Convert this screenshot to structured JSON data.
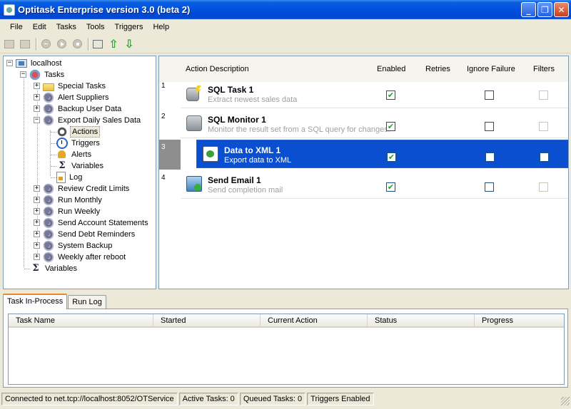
{
  "window": {
    "title": "Optitask Enterprise version 3.0 (beta 2)"
  },
  "menu": [
    "File",
    "Edit",
    "Tasks",
    "Tools",
    "Triggers",
    "Help"
  ],
  "tree": {
    "root": "localhost",
    "tasks_label": "Tasks",
    "tasks": [
      "Special Tasks",
      "Alert Suppliers",
      "Backup User Data",
      "Export Daily Sales Data"
    ],
    "export_children": [
      "Actions",
      "Triggers",
      "Alerts",
      "Variables",
      "Log"
    ],
    "more_tasks": [
      "Review Credit Limits",
      "Run Monthly",
      "Run Weekly",
      "Send Account Statements",
      "Send Debt Reminders",
      "System Backup",
      "Weekly after reboot"
    ],
    "variables_label": "Variables"
  },
  "actions": {
    "columns": [
      "Action Description",
      "Enabled",
      "Retries",
      "Ignore Failure",
      "Filters"
    ],
    "rows": [
      {
        "num": "1",
        "name": "SQL Task 1",
        "desc": "Extract newest sales data",
        "enabled": true,
        "ignore_failure": false,
        "filters": false
      },
      {
        "num": "2",
        "name": "SQL Monitor 1",
        "desc": "Monitor the result set from a SQL query for changes.",
        "enabled": true,
        "ignore_failure": false,
        "filters": false
      },
      {
        "num": "3",
        "name": "Data to XML 1",
        "desc": "Export data to XML",
        "enabled": true,
        "ignore_failure": false,
        "filters": false
      },
      {
        "num": "4",
        "name": "Send Email 1",
        "desc": "Send completion mail",
        "enabled": true,
        "ignore_failure": false,
        "filters": false
      }
    ]
  },
  "tabs": [
    "Task In-Process",
    "Run Log"
  ],
  "process_grid": {
    "columns": [
      "Task Name",
      "Started",
      "Current Action",
      "Status",
      "Progress"
    ]
  },
  "status": {
    "connection": "Connected to net.tcp://localhost:8052/OTService",
    "active": "Active Tasks: 0",
    "queued": "Queued Tasks: 0",
    "triggers": "Triggers Enabled"
  },
  "icons": {
    "check": "✔",
    "minimize": "_",
    "maximize": "❐",
    "close": "✕",
    "arrow_up": "⇧",
    "arrow_down": "⇩",
    "sigma": "Σ",
    "plus": "+",
    "minus": "−"
  }
}
